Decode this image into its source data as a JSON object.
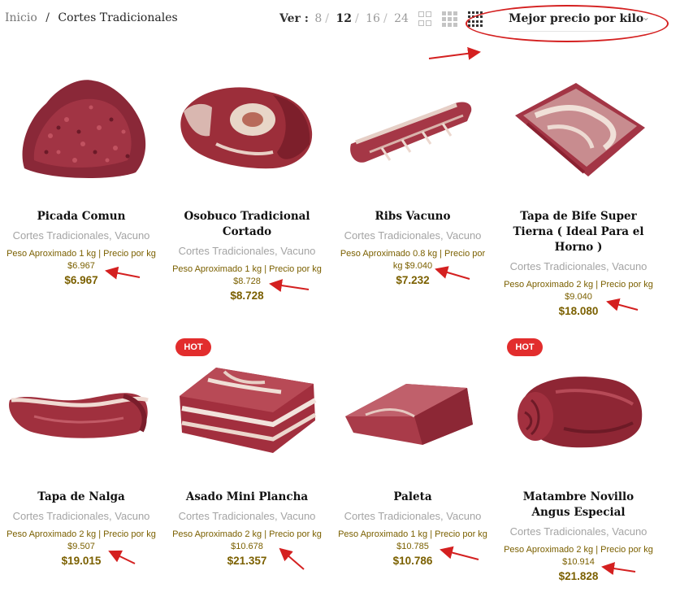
{
  "breadcrumb": {
    "home": "Inicio",
    "separator": "/",
    "current": "Cortes Tradicionales"
  },
  "per_page": {
    "label": "Ver :",
    "options": [
      "8",
      "12",
      "16",
      "24"
    ],
    "selected": "12"
  },
  "view_icons": [
    "grid-2-icon",
    "grid-3-icon",
    "grid-4-icon"
  ],
  "sort": {
    "selected": "Mejor precio por kilo"
  },
  "badge_label": "HOT",
  "colors": {
    "price": "#7b6000",
    "badge": "#e22d2d",
    "annotation": "#d42020"
  },
  "products": [
    {
      "name": "Picada Comun",
      "categories": "Cortes Tradicionales, Vacuno",
      "description": "Peso Aproximado 1 kg | Precio por kg $6.967",
      "price": "$6.967",
      "hot": false
    },
    {
      "name": "Osobuco Tradicional Cortado",
      "categories": "Cortes Tradicionales, Vacuno",
      "description": "Peso Aproximado 1 kg | Precio por kg $8.728",
      "price": "$8.728",
      "hot": false
    },
    {
      "name": "Ribs Vacuno",
      "categories": "Cortes Tradicionales, Vacuno",
      "description": "Peso Aproximado 0.8 kg | Precio por kg $9.040",
      "price": "$7.232",
      "hot": false
    },
    {
      "name": "Tapa de Bife Super Tierna ( Ideal Para el Horno )",
      "categories": "Cortes Tradicionales, Vacuno",
      "description": "Peso Aproximado 2 kg | Precio por kg $9.040",
      "price": "$18.080",
      "hot": false
    },
    {
      "name": "Tapa de Nalga",
      "categories": "Cortes Tradicionales, Vacuno",
      "description": "Peso Aproximado 2 kg | Precio por kg $9.507",
      "price": "$19.015",
      "hot": false
    },
    {
      "name": "Asado Mini Plancha",
      "categories": "Cortes Tradicionales, Vacuno",
      "description": "Peso Aproximado 2 kg | Precio por kg $10.678",
      "price": "$21.357",
      "hot": true
    },
    {
      "name": "Paleta",
      "categories": "Cortes Tradicionales, Vacuno",
      "description": "Peso Aproximado 1 kg | Precio por kg $10.785",
      "price": "$10.786",
      "hot": false
    },
    {
      "name": "Matambre Novillo Angus Especial",
      "categories": "Cortes Tradicionales, Vacuno",
      "description": "Peso Aproximado 2 kg | Precio por kg $10.914",
      "price": "$21.828",
      "hot": true
    }
  ]
}
